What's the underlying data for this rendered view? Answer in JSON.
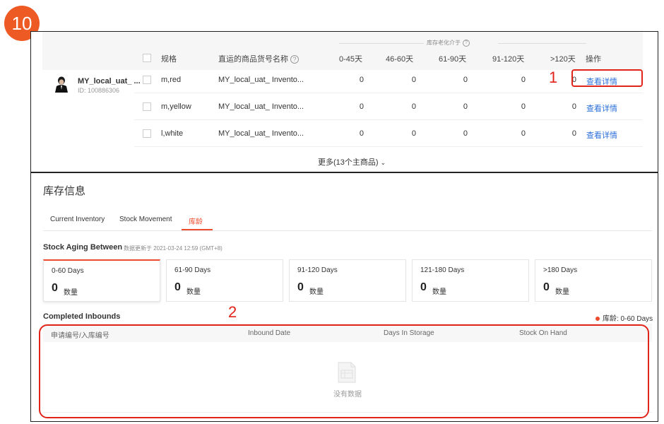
{
  "step_badge": "10",
  "inventory_table": {
    "aging_group_label": "库存老化介于",
    "headers": {
      "spec": "规格",
      "sku_name": "直运的商品货号名称",
      "d0_45": "0-45天",
      "d46_60": "46-60天",
      "d61_90": "61-90天",
      "d91_120": "91-120天",
      "d120p": ">120天",
      "action": "操作"
    },
    "product": {
      "name": "MY_local_uat_ ...",
      "id": "ID: 100886306"
    },
    "rows": [
      {
        "spec": "m,red",
        "sku": "MY_local_uat_ Invento...",
        "d0_45": "0",
        "d46_60": "0",
        "d61_90": "0",
        "d91_120": "0",
        "d120p": "0",
        "action": "查看详情"
      },
      {
        "spec": "m,yellow",
        "sku": "MY_local_uat_ Invento...",
        "d0_45": "0",
        "d46_60": "0",
        "d61_90": "0",
        "d91_120": "0",
        "d120p": "0",
        "action": "查看详情"
      },
      {
        "spec": "l,white",
        "sku": "MY_local_uat_ Invento...",
        "d0_45": "0",
        "d46_60": "0",
        "d61_90": "0",
        "d91_120": "0",
        "d120p": "0",
        "action": "查看详情"
      }
    ],
    "more_label": "更多(13个主商品)"
  },
  "callouts": {
    "one": "1",
    "two": "2"
  },
  "inventory_info": {
    "title": "库存信息",
    "tabs": [
      "Current Inventory",
      "Stock Movement",
      "库龄"
    ],
    "active_tab": "库龄",
    "aging_title": "Stock Aging Between",
    "update_time": "数据更新于 2021-03-24 12:59 (GMT+8)",
    "cards": [
      {
        "label": "0-60 Days",
        "value": "0",
        "unit": "数量"
      },
      {
        "label": "61-90 Days",
        "value": "0",
        "unit": "数量"
      },
      {
        "label": "91-120 Days",
        "value": "0",
        "unit": "数量"
      },
      {
        "label": "121-180 Days",
        "value": "0",
        "unit": "数量"
      },
      {
        "label": ">180 Days",
        "value": "0",
        "unit": "数量"
      }
    ],
    "completed_inbounds_title": "Completed Inbounds",
    "legend": "库龄: 0-60 Days",
    "columns": [
      "申请编号/入库编号",
      "Inbound Date",
      "Days In Storage",
      "Stock On Hand"
    ],
    "empty_text": "没有数据"
  },
  "colors": {
    "accent": "#ee4d2d",
    "callout": "#e2231a",
    "link": "#2b6fd9",
    "badge": "#ed5a23"
  }
}
